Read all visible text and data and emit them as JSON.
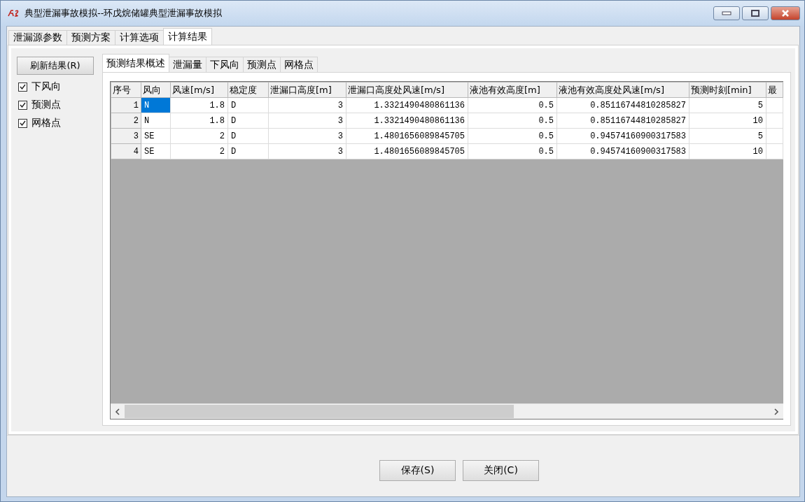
{
  "window": {
    "title": "典型泄漏事故模拟--环戊烷储罐典型泄漏事故模拟"
  },
  "tabs": [
    {
      "label": "泄漏源参数",
      "selected": false
    },
    {
      "label": "预测方案",
      "selected": false
    },
    {
      "label": "计算选项",
      "selected": false
    },
    {
      "label": "计算结果",
      "selected": true
    }
  ],
  "refresh_button": "刷新结果(R)",
  "options": [
    {
      "label": "下风向",
      "checked": true
    },
    {
      "label": "预测点",
      "checked": true
    },
    {
      "label": "网格点",
      "checked": true
    }
  ],
  "sub_tabs": [
    {
      "label": "预测结果概述",
      "selected": true
    },
    {
      "label": "泄漏量",
      "selected": false
    },
    {
      "label": "下风向",
      "selected": false
    },
    {
      "label": "预测点",
      "selected": false
    },
    {
      "label": "网格点",
      "selected": false
    }
  ],
  "table": {
    "columns": [
      "序号",
      "风向",
      "风速[m/s]",
      "稳定度",
      "泄漏口高度[m]",
      "泄漏口高度处风速[m/s]",
      "液池有效高度[m]",
      "液池有效高度处风速[m/s]",
      "预测时刻[min]",
      "最"
    ],
    "rows": [
      {
        "cells": [
          "1",
          "N",
          "1.8",
          "D",
          "3",
          "1.3321490480861136",
          "0.5",
          "0.85116744810285827",
          "5"
        ],
        "selected": true
      },
      {
        "cells": [
          "2",
          "N",
          "1.8",
          "D",
          "3",
          "1.3321490480861136",
          "0.5",
          "0.85116744810285827",
          "10"
        ],
        "selected": false
      },
      {
        "cells": [
          "3",
          "SE",
          "2",
          "D",
          "3",
          "1.4801656089845705",
          "0.5",
          "0.94574160900317583",
          "5"
        ],
        "selected": false
      },
      {
        "cells": [
          "4",
          "SE",
          "2",
          "D",
          "3",
          "1.4801656089845705",
          "0.5",
          "0.94574160900317583",
          "10"
        ],
        "selected": false
      }
    ]
  },
  "buttons": [
    "保存(S)",
    "关闭(C)"
  ]
}
